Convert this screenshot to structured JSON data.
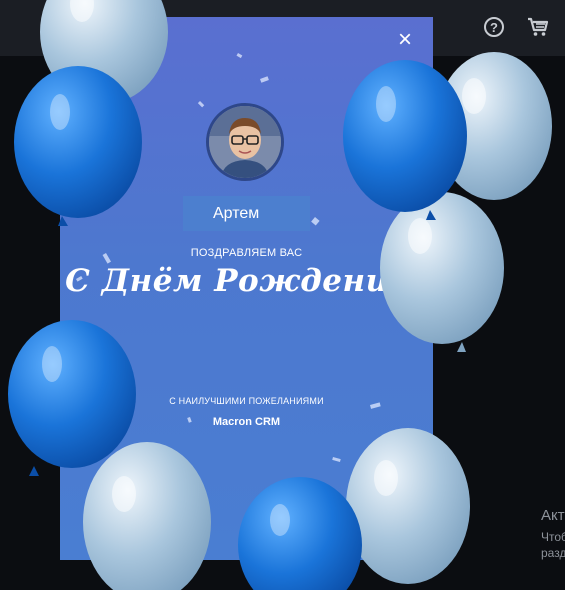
{
  "header": {
    "help_icon": "question-circle-icon",
    "help_glyph": "?",
    "cart_icon": "cart-icon"
  },
  "side_panel": {
    "title": "Акт",
    "line1": "Чтоб",
    "line2": "разд"
  },
  "card": {
    "close_glyph": "×",
    "recipient_name": "Артем",
    "greeting": "ПОЗДРАВЛЯЕМ ВАС",
    "headline": "С Днём Рождения!",
    "wishes": "С НАИЛУЧШИМИ ПОЖЕЛАНИЯМИ",
    "sender": "Macron CRM",
    "background_top": "#5a6fd0",
    "background_bottom": "#4a7ed2"
  },
  "decor": {
    "balloon_dark_blue": "#1a74d9",
    "balloon_light_blue": "#a9c6dd",
    "page_background": "#0b0d11"
  }
}
